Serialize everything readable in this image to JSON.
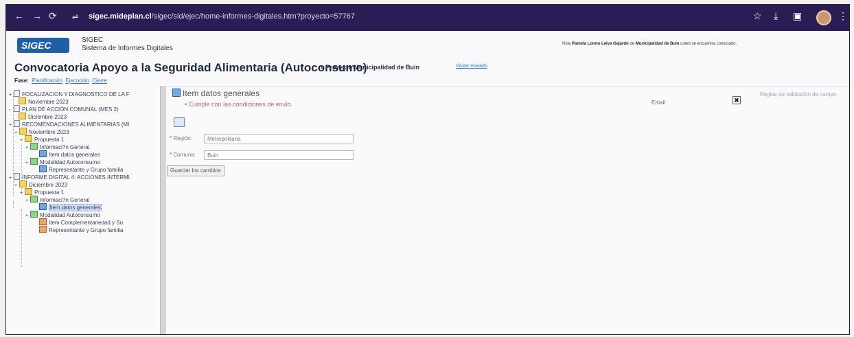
{
  "browser": {
    "url_host": "sigec.mideplan.cl",
    "url_path": "/sigec/sid/ejec/home-informes-digitales.htm?proyecto=57767"
  },
  "app": {
    "logo_text": "SIGEC",
    "name": "SIGEC",
    "subtitle": "Sistema de Informes Digitales",
    "user_message_prefix": "Hola",
    "user_name": "Pamela Loreto Leiva Gajardo",
    "user_message_mid": "de",
    "user_org": "Municipalidad de Buin",
    "user_message_suffix": "usted se encuentra conectado."
  },
  "convocatoria": {
    "title": "Convocatoria Apoyo a la Seguridad Alimentaria (Autoconsumo)",
    "project": "» Proyecto Municipalidad de Buin",
    "link": "Visitar enviado"
  },
  "fase": {
    "label": "Fase:",
    "links": [
      "Planificación",
      "Ejecución",
      "Cierre"
    ]
  },
  "tree": [
    {
      "label": "FOCALIZACION Y DIAGNOSTICO DE LA F",
      "icon": "doc-icon",
      "toggle": "+"
    },
    {
      "label": "Noviembre 2023",
      "icon": "folder-icon",
      "toggle": ""
    },
    {
      "label": "PLAN DE ACCIÓN COMUNAL (MES 2)",
      "icon": "doc-icon",
      "toggle": "-"
    },
    {
      "label": "Diciembre 2023",
      "icon": "folder-icon",
      "toggle": ""
    },
    {
      "label": "RECOMENDACIONES ALIMENTARIAS (MI",
      "icon": "doc-icon",
      "toggle": "+"
    },
    {
      "label": "Noviembre 2023",
      "icon": "folder-icon",
      "toggle": "+"
    },
    {
      "label": "Propuesta 1",
      "icon": "folder-icon",
      "toggle": "+"
    },
    {
      "label": "Informaci?n General",
      "icon": "info-folder-icon",
      "toggle": "+"
    },
    {
      "label": "Item datos generales",
      "icon": "item-icon",
      "toggle": ""
    },
    {
      "label": "Modalidad Autoconsumo",
      "icon": "info-folder-icon",
      "toggle": "+"
    },
    {
      "label": "Representante y Grupo familia",
      "icon": "item-icon",
      "toggle": ""
    },
    {
      "label": "INFORME DIGITAL 4: ACCIONES INTERMI",
      "icon": "doc-icon",
      "toggle": "+"
    },
    {
      "label": "Diciembre 2023",
      "icon": "folder-icon",
      "toggle": "+"
    },
    {
      "label": "Propuesta 1",
      "icon": "folder-icon",
      "toggle": "+"
    },
    {
      "label": "Informaci?n General",
      "icon": "info-folder-icon",
      "toggle": "+"
    },
    {
      "label": "Item datos generales",
      "icon": "item-icon",
      "toggle": ""
    },
    {
      "label": "Modalidad Autoconsumo",
      "icon": "info-folder-icon",
      "toggle": "+"
    },
    {
      "label": "Item Complementariedad y Su",
      "icon": "item-red-icon",
      "toggle": ""
    },
    {
      "label": "Representante y Grupo familia",
      "icon": "item-red-icon",
      "toggle": ""
    }
  ],
  "content": {
    "item_title": "Item datos generales",
    "status": "Cumple con las condiciones de envío.",
    "email_label": "Email",
    "close_glyph": "✖",
    "rules_link": "Reglas de validación de campo",
    "region_label": "Región:",
    "region_value": "Metropolitana",
    "comuna_label": "Comuna:",
    "comuna_value": "Buin",
    "save_label": "Guardar los cambios"
  }
}
